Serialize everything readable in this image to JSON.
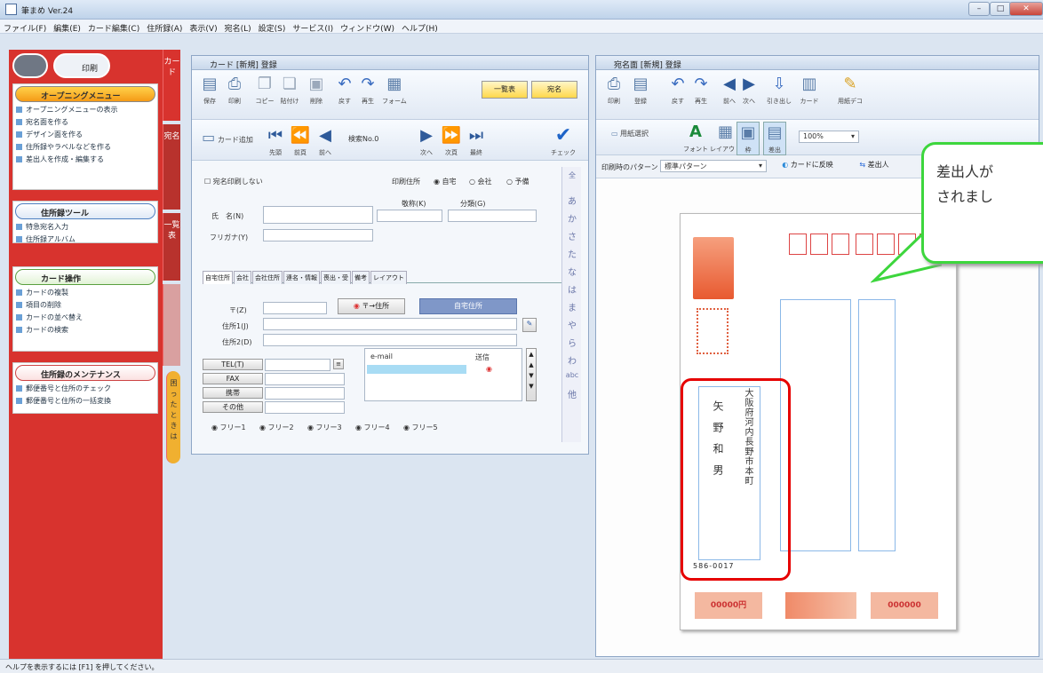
{
  "app": {
    "title": "筆まめ Ver.24",
    "minimize": "–",
    "maximize": "□",
    "close": "✕"
  },
  "menu": [
    "ファイル(F)",
    "編集(E)",
    "カード編集(C)",
    "住所録(A)",
    "表示(V)",
    "宛名(L)",
    "設定(S)",
    "サービス(I)",
    "ウィンドウ(W)",
    "ヘルプ(H)"
  ],
  "sidebar": {
    "top_buttons": [
      "",
      "印刷"
    ],
    "opening_menu": {
      "title": "オープニングメニュー",
      "items": [
        "オープニングメニューの表示",
        "宛名面を作る",
        "デザイン面を作る",
        "住所録やラベルなどを作る",
        "差出人を作成・編集する"
      ]
    },
    "address_tools": {
      "title": "住所録ツール",
      "items": [
        "特急宛名入力",
        "住所録アルバム"
      ]
    },
    "card_ops": {
      "title": "カード操作",
      "items": [
        "カードの複製",
        "項目の削除",
        "カードの並べ替え",
        "カードの検索"
      ]
    },
    "maintenance": {
      "title": "住所録のメンテナンス",
      "items": [
        "郵便番号と住所のチェック",
        "郵便番号と住所の一括変換"
      ]
    },
    "vtabs": [
      "カード",
      "宛名",
      "一覧表",
      "",
      "困ったときは"
    ]
  },
  "card_window": {
    "title": "カード [新規] 登録",
    "toolbar": [
      "保存",
      "印刷",
      "コピー",
      "貼付け",
      "削除",
      "戻す",
      "再生",
      "フォーム"
    ],
    "right_buttons": [
      "一覧表",
      "宛名"
    ],
    "nav": {
      "add": "カード追加",
      "buttons": [
        "先頭",
        "前頁",
        "前へ"
      ],
      "record": "検索No.0",
      "next_buttons": [
        "次へ",
        "次頁",
        "最終"
      ],
      "check": "チェック"
    },
    "print_toggle": "宛名印刷しない",
    "print_addr": {
      "label": "印刷住所",
      "options": [
        "自宅",
        "会社",
        "予備"
      ]
    },
    "name_label": "氏　名(N)",
    "furigana_label": "フリガナ(Y)",
    "title_label": "敬称(K)",
    "category_label": "分類(G)",
    "tabs": [
      "自宅住所",
      "会社",
      "会社住所",
      "連名・情報",
      "喪出・受",
      "備考",
      "レイアウト"
    ],
    "postal_label": "〒(Z)",
    "postal_btn": "〒→住所",
    "home_addr_btn": "自宅住所",
    "addr1_label": "住所1(J)",
    "addr2_label": "住所2(D)",
    "contacts": [
      "TEL(T)",
      "FAX",
      "携帯",
      "その他"
    ],
    "email_header": [
      "e-mail",
      "送信"
    ],
    "footer": [
      "フリー1",
      "フリー2",
      "フリー3",
      "フリー4",
      "フリー5"
    ],
    "kana_index": [
      "全",
      "あ",
      "か",
      "さ",
      "た",
      "な",
      "は",
      "ま",
      "や",
      "ら",
      "わ",
      "abc",
      "他"
    ]
  },
  "print_window": {
    "title": "宛名面 [新規] 登録",
    "toolbar": [
      "印刷",
      "登録",
      "戻す",
      "再生",
      "前へ",
      "次へ",
      "引き出し",
      "カード",
      "用紙デコ"
    ],
    "toolbar2": [
      "用紙選択",
      "フォント",
      "レイアウト",
      "枠",
      "差出"
    ],
    "zoom": "100%",
    "pattern_label": "印刷時のパターン",
    "pattern_value": "標準パターン",
    "to_card": "カードに反映",
    "extra_btn": "差出人"
  },
  "postcard": {
    "sender_address": "大阪府河内長野市本町",
    "sender_name": "矢野和男",
    "postal_digits": "586-0017",
    "stamp_values": [
      "00000円",
      "000000"
    ]
  },
  "callout": {
    "line1": "差出人が",
    "line2": "されまし"
  },
  "status": "ヘルプを表示するには [F1] を押してください。"
}
